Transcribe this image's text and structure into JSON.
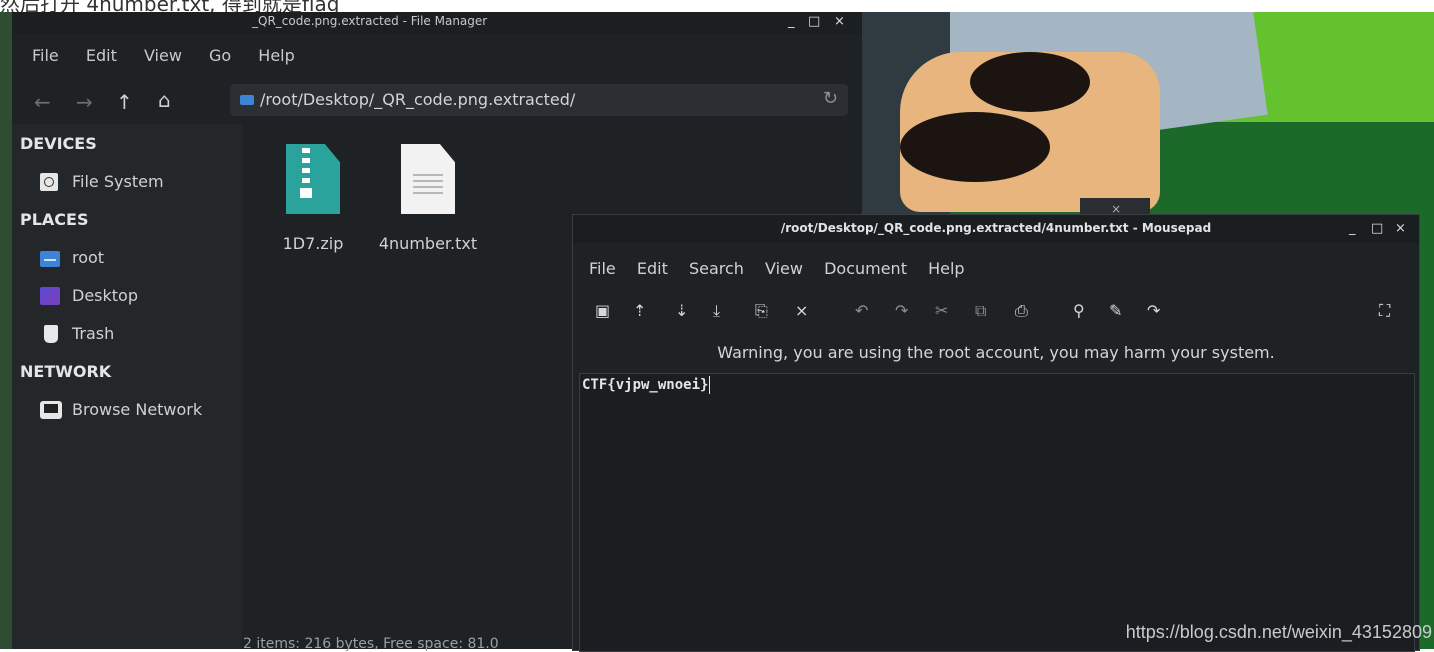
{
  "caption": "然后打开 4number.txt, 得到就是flag",
  "file_manager": {
    "title": "_QR_code.png.extracted - File Manager",
    "menu": [
      "File",
      "Edit",
      "View",
      "Go",
      "Help"
    ],
    "path": "/root/Desktop/_QR_code.png.extracted/",
    "sidebar": {
      "devices_header": "DEVICES",
      "devices": [
        {
          "label": "File System",
          "icon": "harddisk-icon"
        }
      ],
      "places_header": "PLACES",
      "places": [
        {
          "label": "root",
          "icon": "folder-icon"
        },
        {
          "label": "Desktop",
          "icon": "desktop-icon"
        },
        {
          "label": "Trash",
          "icon": "trash-icon"
        }
      ],
      "network_header": "NETWORK",
      "network": [
        {
          "label": "Browse Network",
          "icon": "network-icon"
        }
      ]
    },
    "files": [
      {
        "name": "1D7.zip",
        "icon": "zip-file-icon"
      },
      {
        "name": "4number.txt",
        "icon": "text-file-icon"
      }
    ],
    "status": "2 items: 216 bytes, Free space: 81.0"
  },
  "mousepad": {
    "title": "/root/Desktop/_QR_code.png.extracted/4number.txt - Mousepad",
    "menu": [
      "File",
      "Edit",
      "Search",
      "View",
      "Document",
      "Help"
    ],
    "warning": "Warning, you are using the root account, you may harm your system.",
    "content": "CTF{vjpw_wnoei}"
  },
  "window_controls": {
    "minimize": "_",
    "maximize": "□",
    "close": "×"
  },
  "watermark": "https://blog.csdn.net/weixin_43152809",
  "colors": {
    "background": "#1f2225",
    "folder_blue": "#3d83d6",
    "zip_teal": "#2aa39c"
  }
}
